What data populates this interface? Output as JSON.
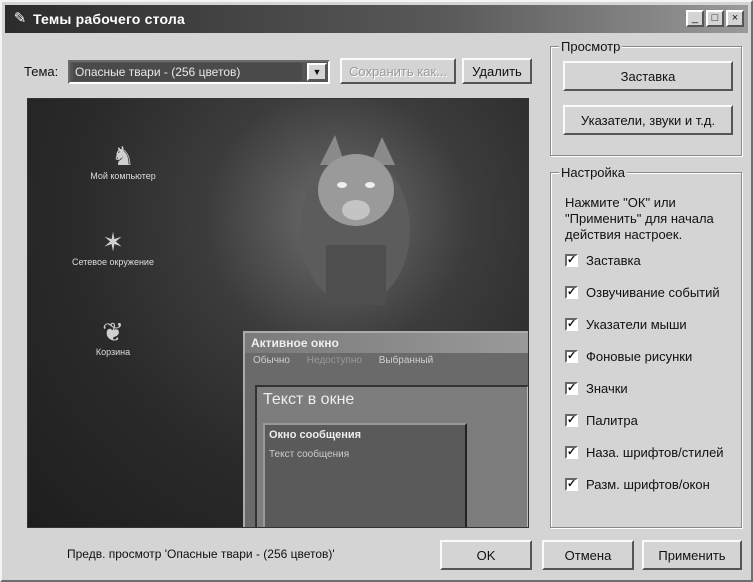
{
  "window": {
    "title": "Темы рабочего стола",
    "controls": [
      "_",
      "□",
      "×"
    ]
  },
  "theme": {
    "label": "Тема:",
    "selected": "Опасные твари - (256 цветов)",
    "save_as": "Сохранить как...",
    "delete": "Удалить"
  },
  "preview_desktop": {
    "icons": [
      "Мой компьютер",
      "Сетевое окружение",
      "Корзина"
    ],
    "active_window_title": "Активное окно",
    "menu_items": [
      "Обычно",
      "Недоступно",
      "Выбранный"
    ],
    "window_text": "Текст в окне",
    "message_box_title": "Окно сообщения",
    "message_text": "Текст сообщения"
  },
  "view_group": {
    "legend": "Просмотр",
    "screensaver_button": "Заставка",
    "pointers_button": "Указатели, звуки и т.д."
  },
  "settings_group": {
    "legend": "Настройка",
    "note": "Нажмите \"ОК\" или \"Применить\" для начала действия настроек.",
    "items": [
      {
        "label": "Заставка",
        "checked": true
      },
      {
        "label": "Озвучивание событий",
        "checked": true
      },
      {
        "label": "Указатели мыши",
        "checked": true
      },
      {
        "label": "Фоновые рисунки",
        "checked": true
      },
      {
        "label": "Значки",
        "checked": true
      },
      {
        "label": "Палитра",
        "checked": true
      },
      {
        "label": "Наза. шрифтов/стилей",
        "checked": true
      },
      {
        "label": "Разм. шрифтов/окон",
        "checked": true
      }
    ]
  },
  "status_text": "Предв. просмотр 'Опасные твари - (256 цветов)'",
  "buttons": {
    "ok": "OK",
    "cancel": "Отмена",
    "apply": "Применить"
  }
}
